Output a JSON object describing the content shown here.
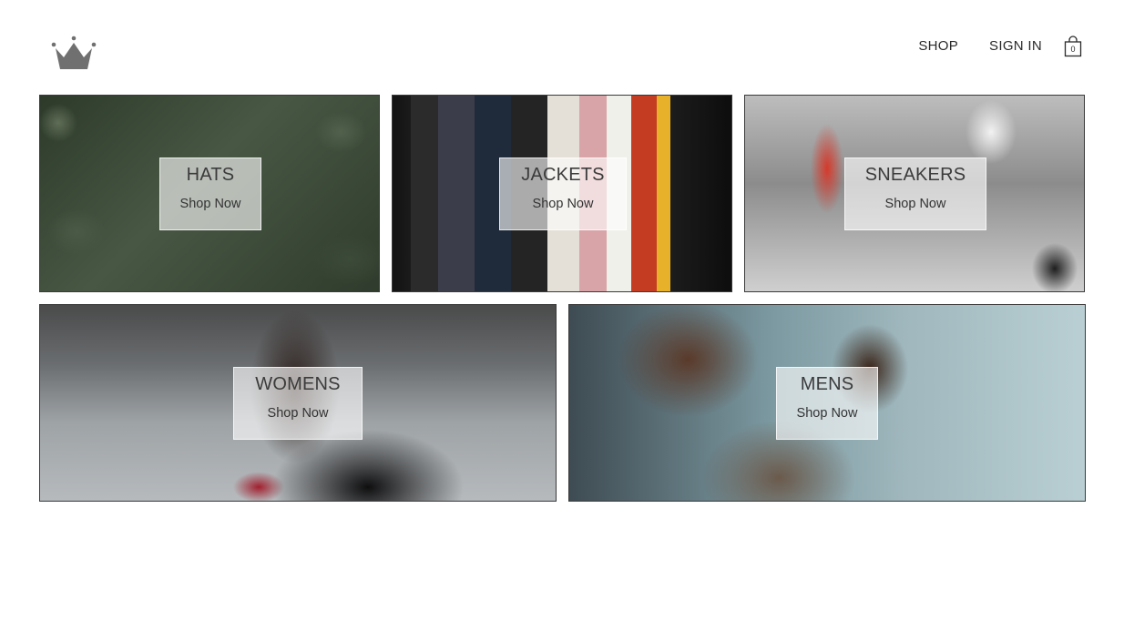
{
  "header": {
    "logo_icon": "crown-icon",
    "nav": {
      "shop_label": "SHOP",
      "sign_in_label": "SIGN IN",
      "cart_icon": "shopping-bag-icon",
      "cart_count": "0"
    }
  },
  "directory": {
    "hats": {
      "title": "HATS",
      "subtitle": "Shop Now"
    },
    "jackets": {
      "title": "JACKETS",
      "subtitle": "Shop Now"
    },
    "sneakers": {
      "title": "SNEAKERS",
      "subtitle": "Shop Now"
    },
    "womens": {
      "title": "WOMENS",
      "subtitle": "Shop Now"
    },
    "mens": {
      "title": "MENS",
      "subtitle": "Shop Now"
    }
  },
  "colors": {
    "background": "#ffffff",
    "text": "#2a2a2a",
    "logo": "#707070",
    "tile_border": "#3a3a3a"
  }
}
